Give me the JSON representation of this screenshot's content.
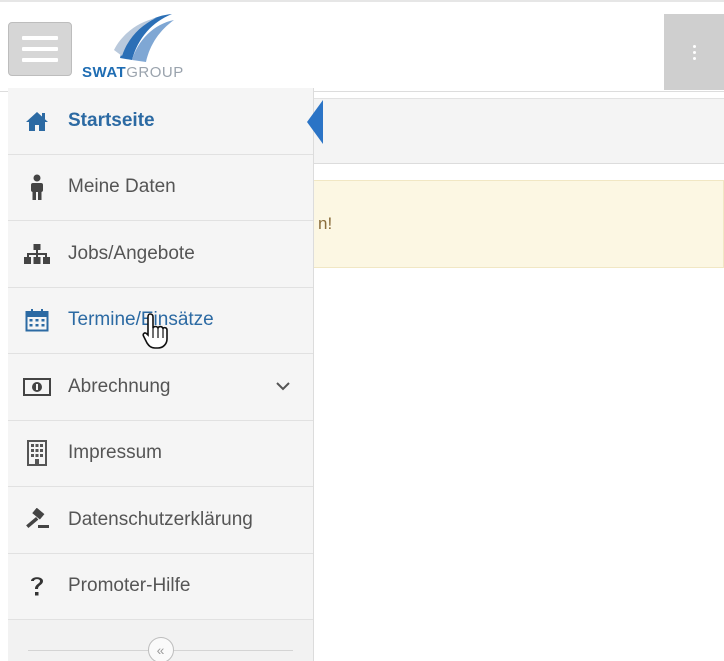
{
  "header": {
    "logo": {
      "part1": "SWAT",
      "part2": "GROUP"
    }
  },
  "content": {
    "alert_text": "n!"
  },
  "sidebar": {
    "items": [
      {
        "label": "Startseite",
        "icon": "home-icon"
      },
      {
        "label": "Meine Daten",
        "icon": "person-icon"
      },
      {
        "label": "Jobs/Angebote",
        "icon": "sitemap-icon"
      },
      {
        "label": "Termine/Einsätze",
        "icon": "calendar-icon"
      },
      {
        "label": "Abrechnung",
        "icon": "money-icon"
      },
      {
        "label": "Impressum",
        "icon": "building-icon"
      },
      {
        "label": "Datenschutzerklärung",
        "icon": "gavel-icon"
      },
      {
        "label": "Promoter-Hilfe",
        "icon": "question-icon"
      }
    ],
    "collapse_symbol": "«"
  },
  "colors": {
    "accent": "#2b74c6",
    "link": "#2c6aa3",
    "alert_bg": "#fcf7e3"
  }
}
